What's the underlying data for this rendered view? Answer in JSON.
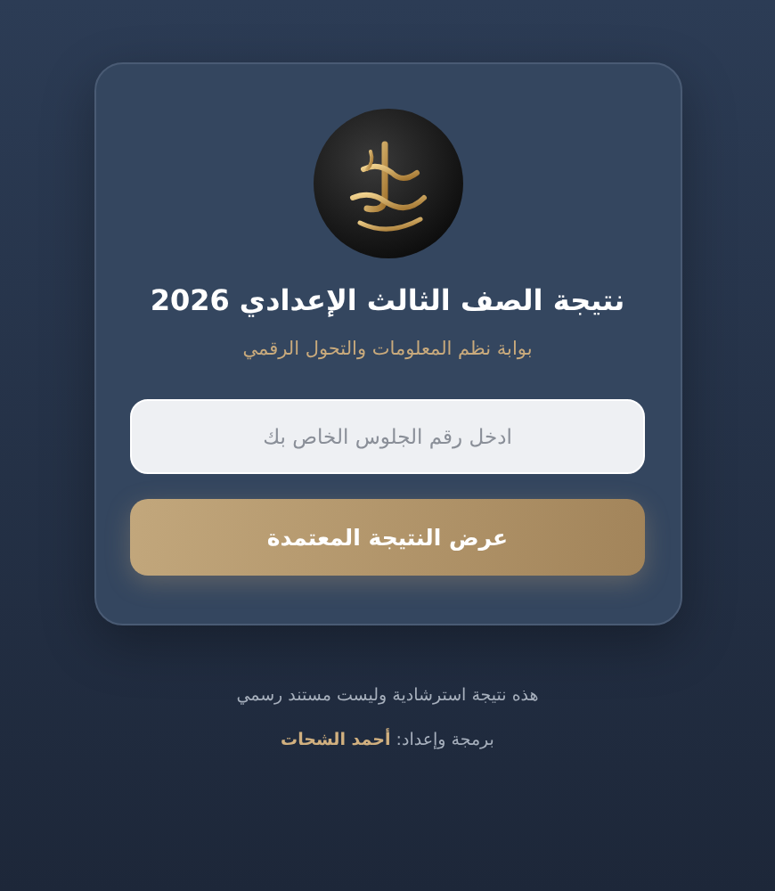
{
  "card": {
    "title": "نتيجة الصف الثالث الإعدادي 2026",
    "subtitle": "بوابة نظم المعلومات والتحول الرقمي",
    "seat_field": {
      "placeholder": "ادخل رقم الجلوس الخاص بك"
    },
    "submit_button": "عرض النتيجة المعتمدة"
  },
  "footer": {
    "disclaimer": "هذه نتيجة استرشادية وليست مستند رسمي",
    "credits": "برمجة وإعداد: **أحمد الشحات**"
  }
}
